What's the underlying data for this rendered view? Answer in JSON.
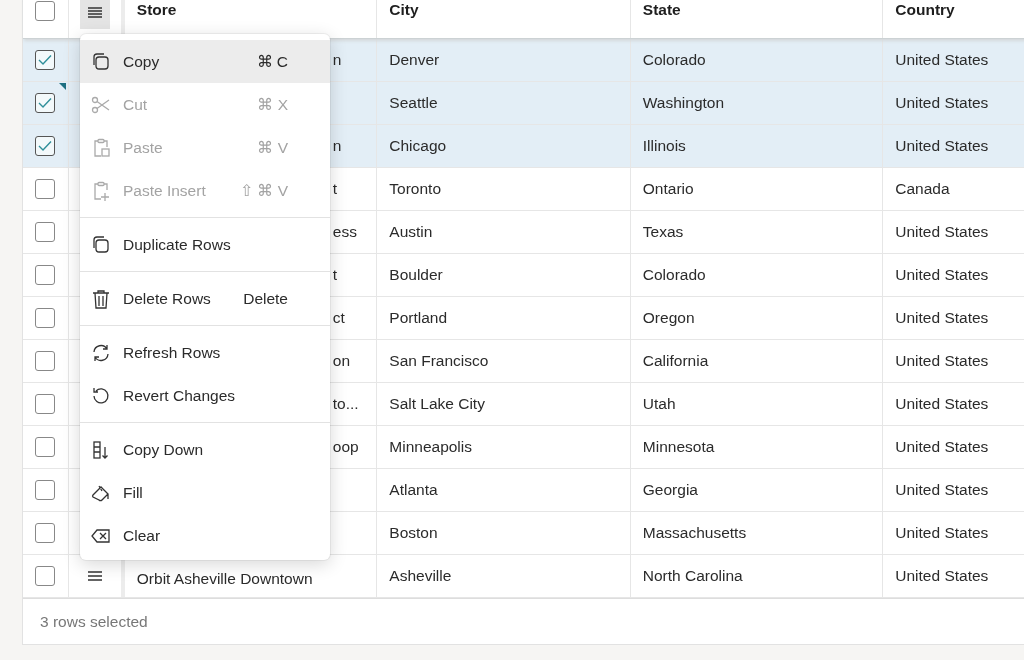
{
  "table": {
    "all_selected": false,
    "columns": [
      "Store",
      "City",
      "State",
      "Country"
    ],
    "rows": [
      {
        "selected": true,
        "store": "n",
        "city": "Denver",
        "state": "Colorado",
        "country": "United States"
      },
      {
        "selected": true,
        "city": "Seattle",
        "state": "Washington",
        "country": "United States"
      },
      {
        "selected": true,
        "store": "n",
        "city": "Chicago",
        "state": "Illinois",
        "country": "United States"
      },
      {
        "selected": false,
        "store": "t",
        "city": "Toronto",
        "state": "Ontario",
        "country": "Canada"
      },
      {
        "selected": false,
        "store": "ess",
        "city": "Austin",
        "state": "Texas",
        "country": "United States"
      },
      {
        "selected": false,
        "store": "t",
        "city": "Boulder",
        "state": "Colorado",
        "country": "United States"
      },
      {
        "selected": false,
        "store": "ct",
        "city": "Portland",
        "state": "Oregon",
        "country": "United States"
      },
      {
        "selected": false,
        "store": "on",
        "city": "San Francisco",
        "state": "California",
        "country": "United States"
      },
      {
        "selected": false,
        "store": "to...",
        "city": "Salt Lake City",
        "state": "Utah",
        "country": "United States"
      },
      {
        "selected": false,
        "store": "oop",
        "city": "Minneapolis",
        "state": "Minnesota",
        "country": "United States"
      },
      {
        "selected": false,
        "city": "Atlanta",
        "state": "Georgia",
        "country": "United States"
      },
      {
        "selected": false,
        "city": "Boston",
        "state": "Massachusetts",
        "country": "United States"
      },
      {
        "selected": false,
        "store": "Orbit Asheville Downtown",
        "city": "Asheville",
        "state": "North Carolina",
        "country": "United States"
      }
    ]
  },
  "context_menu": {
    "groups": [
      [
        {
          "label": "Copy",
          "shortcut": "⌘ C",
          "disabled": false,
          "highlighted": true
        },
        {
          "label": "Cut",
          "shortcut": "⌘ X",
          "disabled": true,
          "highlighted": false
        },
        {
          "label": "Paste",
          "shortcut": "⌘ V",
          "disabled": true,
          "highlighted": false
        },
        {
          "label": "Paste Insert",
          "shortcut": "⇧ ⌘ V",
          "disabled": true,
          "highlighted": false
        }
      ],
      [
        {
          "label": "Duplicate Rows",
          "disabled": false,
          "highlighted": false
        }
      ],
      [
        {
          "label": "Delete Rows",
          "shortcut": "Delete",
          "disabled": false,
          "highlighted": false
        }
      ],
      [
        {
          "label": "Refresh Rows",
          "disabled": false,
          "highlighted": false
        },
        {
          "label": "Revert Changes",
          "disabled": false,
          "highlighted": false
        }
      ],
      [
        {
          "label": "Copy Down",
          "disabled": false,
          "highlighted": false
        },
        {
          "label": "Fill",
          "disabled": false,
          "highlighted": false
        },
        {
          "label": "Clear",
          "disabled": false,
          "highlighted": false
        }
      ]
    ]
  },
  "status_bar": "3 rows selected"
}
